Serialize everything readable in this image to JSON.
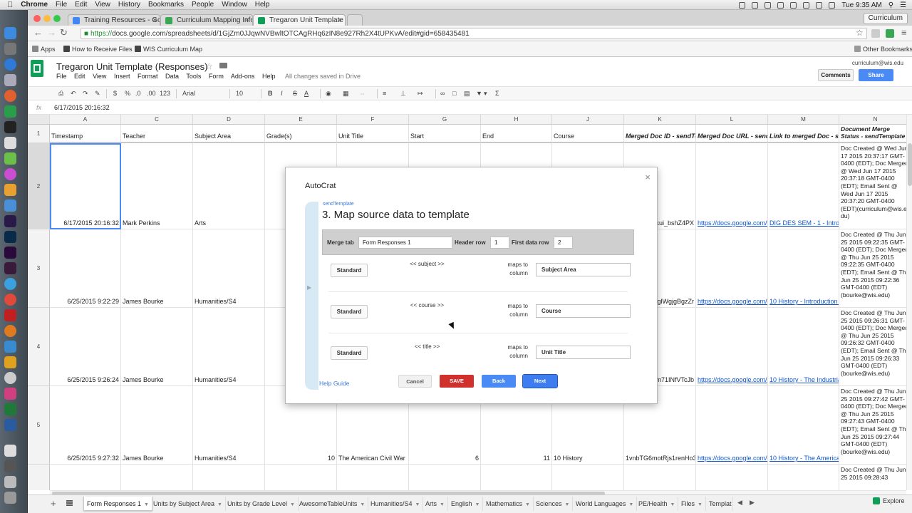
{
  "macbar": {
    "apple": "",
    "app": "Chrome",
    "menus": [
      "File",
      "Edit",
      "View",
      "History",
      "Bookmarks",
      "People",
      "Window",
      "Help"
    ],
    "clock": "Tue 9:35 AM",
    "profile": "Curriculum"
  },
  "browser": {
    "tabs": [
      {
        "title": "Training Resources - Goog",
        "close": "×"
      },
      {
        "title": "Curriculum Mapping Infogra",
        "close": "×"
      },
      {
        "title": "Tregaron Unit Template (Re",
        "close": "×"
      }
    ],
    "profile_button": "Curriculum",
    "back": "←",
    "forward": "→",
    "reload": "↻",
    "url_scheme": "https://",
    "url_rest": "docs.google.com/spreadsheets/d/1GjZm0JJqwNVBwltOTCAgRHq6zIN8e927Rh2X4tUPKvA/edit#gid=658435481",
    "bookmarks": [
      "Apps",
      "How to Receive Files",
      "WIS Curriculum Map"
    ],
    "other_bookmarks": "Other Bookmarks"
  },
  "sheet": {
    "title": "Tregaron Unit Template (Responses)",
    "menus": [
      "File",
      "Edit",
      "View",
      "Insert",
      "Format",
      "Data",
      "Tools",
      "Form",
      "Add-ons",
      "Help"
    ],
    "saved_status": "All changes saved in Drive",
    "user_email": "curriculum@wis.edu",
    "comments_label": "Comments",
    "share_label": "Share",
    "toolbar": {
      "dollar": "$",
      "percent": "%",
      "dec_less": ".0",
      "dec_more": ".00",
      "num_format": "123",
      "font": "Arial",
      "size": "10",
      "bold": "B",
      "italic": "I",
      "strike": "S",
      "color": "A",
      "sum": "Σ"
    },
    "formula_label": "fx",
    "formula_value": "6/17/2015 20:16:32"
  },
  "grid": {
    "columns": [
      {
        "letter": "A",
        "header": "Timestamp"
      },
      {
        "letter": "C",
        "header": "Teacher"
      },
      {
        "letter": "D",
        "header": "Subject Area"
      },
      {
        "letter": "E",
        "header": "Grade(s)"
      },
      {
        "letter": "F",
        "header": "Unit Title"
      },
      {
        "letter": "G",
        "header": "Start"
      },
      {
        "letter": "H",
        "header": "End"
      },
      {
        "letter": "J",
        "header": "Course"
      },
      {
        "letter": "K",
        "header": "Merged Doc ID - sendTe"
      },
      {
        "letter": "L",
        "header": "Merged Doc URL - send"
      },
      {
        "letter": "M",
        "header": "Link to merged Doc - se"
      },
      {
        "letter": "N",
        "header": "Document Merge Status - sendTemplate"
      }
    ],
    "rows": [
      {
        "num": "1"
      },
      {
        "num": "2",
        "timestamp": "6/17/2015 20:16:32",
        "teacher": "Mark Perkins",
        "subject": "Arts",
        "grade": "",
        "unit": "",
        "start": "",
        "end": "",
        "course": "",
        "docid": "6kui_bshZ4PX",
        "url": "https://docs.google.com/d",
        "link": "DIG DES SEM - 1 - Introd",
        "status": "Doc Created @ Wed Jun 17 2015 20:37:17 GMT-0400 (EDT); Doc Merged @ Wed Jun 17 2015 20:37:18 GMT-0400 (EDT); Email Sent @ Wed Jun 17 2015 20:37:20 GMT-0400 (EDT)(curriculum@wis.e du)"
      },
      {
        "num": "3",
        "timestamp": "6/25/2015 9:22:29",
        "teacher": "James Bourke",
        "subject": "Humanities/S4",
        "grade": "",
        "unit": "",
        "start": "",
        "end": "",
        "course": "",
        "docid": "gglWgjgBgzZr",
        "url": "https://docs.google.com/d",
        "link": "10 History - Introduction t",
        "status": "Doc Created @ Thu Jun 25 2015 09:22:35 GMT-0400 (EDT); Doc Merged @ Thu Jun 25 2015 09:22:35 GMT-0400 (EDT); Email Sent @ Thu Jun 25 2015 09:22:36 GMT-0400 (EDT)(bourke@wis.edu)"
      },
      {
        "num": "4",
        "timestamp": "6/25/2015 9:26:24",
        "teacher": "James Bourke",
        "subject": "Humanities/S4",
        "grade": "",
        "unit": "",
        "start": "",
        "end": "",
        "course": "",
        "docid": "m71INfVTcJb",
        "url": "https://docs.google.com/d",
        "link": "10 History - The Industria",
        "status": "Doc Created @ Thu Jun 25 2015 09:26:31 GMT-0400 (EDT); Doc Merged @ Thu Jun 25 2015 09:26:32 GMT-0400 (EDT); Email Sent @ Thu Jun 25 2015 09:26:33 GMT-0400 (EDT)(bourke@wis.edu)"
      },
      {
        "num": "5",
        "timestamp": "6/25/2015 9:27:32",
        "teacher": "James Bourke",
        "subject": "Humanities/S4",
        "grade": "10",
        "unit": "The American Civil War",
        "start": "6",
        "end": "11",
        "course": "10 History",
        "docid": "1vnbTG6motRjs1renHo3i",
        "url": "https://docs.google.com/d",
        "link": "10 History - The America",
        "status": "Doc Created @ Thu Jun 25 2015 09:27:42 GMT-0400 (EDT); Doc Merged @ Thu Jun 25 2015 09:27:43 GMT-0400 (EDT); Email Sent @ Thu Jun 25 2015 09:27:44 GMT-0400 (EDT)(bourke@wis.edu)"
      },
      {
        "num": "",
        "status": "Doc Created @ Thu Jun 25 2015 09:28:43"
      }
    ]
  },
  "sheet_tabs": [
    "Form Responses 1",
    "Units by Subject Area",
    "Units by Grade Level",
    "AwesomeTableUnits",
    "Humanities/S4",
    "Arts",
    "English",
    "Mathematics",
    "Sciences",
    "World Languages",
    "PE/Health",
    "Files",
    "Templat"
  ],
  "explore_label": "Explore",
  "dialog": {
    "title": "AutoCrat",
    "close": "×",
    "step_label": "sendTemplate",
    "step_heading": "3. Map source data to template",
    "merge_tab_label": "Merge tab",
    "merge_tab_value": "Form Responses 1",
    "header_row_label": "Header row",
    "header_row_value": "1",
    "first_data_row_label": "First data row",
    "first_data_row_value": "2",
    "mappings": [
      {
        "type": "Standard",
        "tag": "<< subject >>",
        "maps_to": "maps to column",
        "column": "Subject Area"
      },
      {
        "type": "Standard",
        "tag": "<< course >>",
        "maps_to": "maps to column",
        "column": "Course"
      },
      {
        "type": "Standard",
        "tag": "<< title >>",
        "maps_to": "maps to column",
        "column": "Unit Title"
      }
    ],
    "help_guide": "Help Guide",
    "cancel": "Cancel",
    "save": "SAVE",
    "back": "Back",
    "next": "Next"
  },
  "colors": {
    "sheets_green": "#0f9d58",
    "share_blue": "#4a8af4",
    "save_red": "#d0312d",
    "link_blue": "#1155cc"
  }
}
